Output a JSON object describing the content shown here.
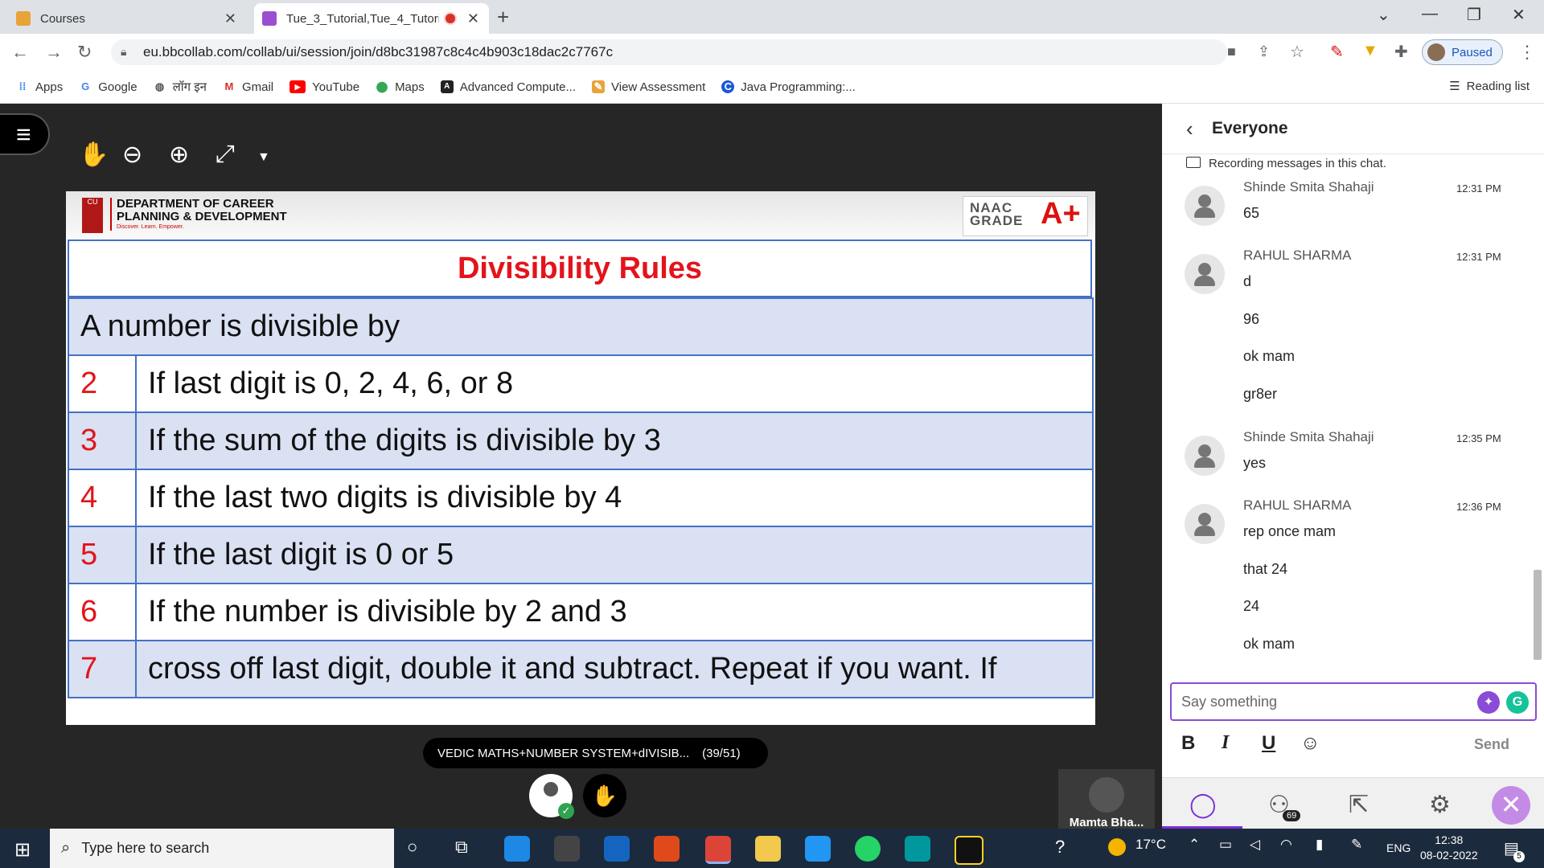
{
  "browser": {
    "tabs": [
      {
        "title": "Courses",
        "favicon_color": "#e8a33a"
      },
      {
        "title": "Tue_3_Tutorial,Tue_4_Tutoria",
        "favicon_color": "#9b4fd0",
        "recording": true
      }
    ],
    "url": "eu.bbcollab.com/collab/ui/session/join/d8bc31987c8c4c4b903c18dac2c7767c",
    "profile_status": "Paused",
    "bookmarks": [
      {
        "label": "Apps",
        "icon": "apps-grid-icon"
      },
      {
        "label": "Google",
        "icon": "google-icon"
      },
      {
        "label": "लॉग इन",
        "icon": "globe-icon"
      },
      {
        "label": "Gmail",
        "icon": "gmail-icon"
      },
      {
        "label": "YouTube",
        "icon": "youtube-icon"
      },
      {
        "label": "Maps",
        "icon": "maps-pin-icon"
      },
      {
        "label": "Advanced Compute...",
        "icon": "advanced-compute-icon"
      },
      {
        "label": "View Assessment",
        "icon": "assessment-icon"
      },
      {
        "label": "Java Programming:...",
        "icon": "java-c-icon"
      }
    ],
    "reading_list": "Reading list"
  },
  "slide": {
    "dept_line1": "DEPARTMENT OF CAREER",
    "dept_line2": "PLANNING & DEVELOPMENT",
    "dept_tag": "Discover. Learn. Empower.",
    "naac_line1": "NAAC",
    "naac_line2": "GRADE",
    "naac_grade": "A+",
    "title": "Divisibility Rules",
    "header_row": "A number is divisible by",
    "rows": [
      {
        "n": "2",
        "rule": "If last digit is 0, 2, 4, 6, or 8"
      },
      {
        "n": "3",
        "rule": "If the sum of the digits is divisible by 3"
      },
      {
        "n": "4",
        "rule": "If the last two digits is divisible by 4"
      },
      {
        "n": "5",
        "rule": "If the last digit is 0 or 5"
      },
      {
        "n": "6",
        "rule": "If the number is divisible by 2 and 3"
      },
      {
        "n": "7",
        "rule": "cross off last digit, double it and subtract. Repeat if you want. If"
      }
    ]
  },
  "file": {
    "name": "VEDIC MATHS+NUMBER SYSTEM+dIVISIB...",
    "page": "(39/51)"
  },
  "participant": {
    "name": "Mamta Bha..."
  },
  "chat": {
    "header": "Everyone",
    "recording_note": "Recording messages in this chat.",
    "messages": [
      {
        "name": "Shinde Smita Shahaji",
        "time": "12:31 PM",
        "lines": [
          "65"
        ]
      },
      {
        "name": "RAHUL SHARMA",
        "time": "12:31 PM",
        "lines": [
          "d",
          "96",
          "ok mam",
          "gr8er"
        ]
      },
      {
        "name": "Shinde Smita Shahaji",
        "time": "12:35 PM",
        "lines": [
          "yes"
        ]
      },
      {
        "name": "RAHUL SHARMA",
        "time": "12:36 PM",
        "lines": [
          "rep once mam",
          "that 24",
          "24",
          "ok mam"
        ]
      }
    ],
    "composer_placeholder": "Say something",
    "send_label": "Send",
    "attendees_count": "69"
  },
  "taskbar": {
    "search_placeholder": "Type here to search",
    "temperature": "17°C",
    "language": "ENG",
    "time": "12:38",
    "date": "08-02-2022",
    "notification_count": "5"
  }
}
